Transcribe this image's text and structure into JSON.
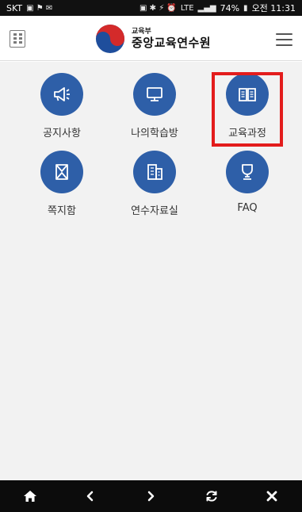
{
  "status_bar": {
    "carrier": "SKT",
    "battery": "74%",
    "time": "오전 11:31",
    "network": "LTE"
  },
  "header": {
    "logo_small": "교육부",
    "logo_big": "중앙교육연수원"
  },
  "menu": {
    "items": [
      {
        "label": "공지사항",
        "icon": "megaphone-icon"
      },
      {
        "label": "나의학습방",
        "icon": "monitor-icon"
      },
      {
        "label": "교육과정",
        "icon": "book-icon",
        "highlighted": true
      },
      {
        "label": "쪽지함",
        "icon": "envelope-icon"
      },
      {
        "label": "연수자료실",
        "icon": "documents-icon"
      },
      {
        "label": "FAQ",
        "icon": "trophy-icon"
      }
    ]
  },
  "colors": {
    "accent": "#2e5fa8",
    "highlight": "#e31c1c",
    "background": "#f2f2f2",
    "bottom_bar": "#0c0c0c"
  },
  "bottom_nav": {
    "items": [
      "home-icon",
      "back-icon",
      "forward-icon",
      "refresh-icon",
      "close-icon"
    ]
  }
}
